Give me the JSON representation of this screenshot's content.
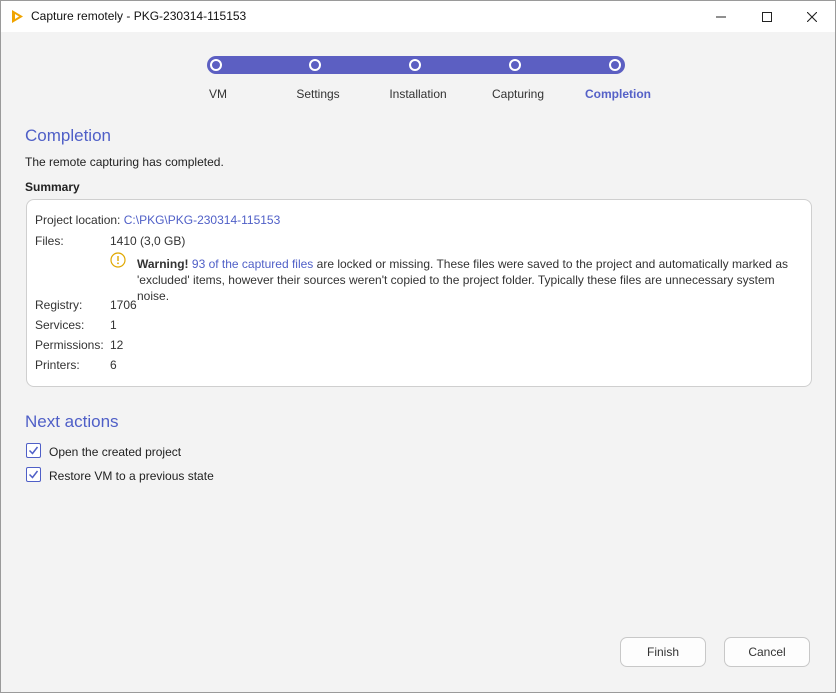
{
  "window": {
    "title": "Capture remotely - PKG-230314-115153",
    "brand_color": "#f0a400",
    "accent_color": "#5c5fc2"
  },
  "stepper": {
    "steps": [
      {
        "label": "VM"
      },
      {
        "label": "Settings"
      },
      {
        "label": "Installation"
      },
      {
        "label": "Capturing"
      },
      {
        "label": "Completion",
        "active": true
      }
    ]
  },
  "completion": {
    "heading": "Completion",
    "message": "The remote capturing has completed.",
    "summary_label": "Summary"
  },
  "summary": {
    "project_location_label": "Project location:",
    "project_location_value": "C:\\PKG\\PKG-230314-115153",
    "files_label": "Files:",
    "files_value": "1410 (3,0 GB)",
    "warning_title": "Warning!",
    "warning_link": "93 of the captured files",
    "warning_text": " are locked or missing. These files were saved to the project and automatically marked as 'excluded' items, however their sources weren't copied to the project folder. Typically these files are unnecessary system noise.",
    "registry_label": "Registry:",
    "registry_value": "1706",
    "services_label": "Services:",
    "services_value": "1",
    "permissions_label": "Permissions:",
    "permissions_value": "12",
    "printers_label": "Printers:",
    "printers_value": "6"
  },
  "next_actions": {
    "heading": "Next actions",
    "items": [
      {
        "label": "Open the created project",
        "checked": true
      },
      {
        "label": "Restore VM to a previous state",
        "checked": true
      }
    ]
  },
  "footer": {
    "finish_label": "Finish",
    "cancel_label": "Cancel"
  },
  "icons": {
    "app": "capture-app-icon",
    "minimize": "minimize-icon",
    "maximize": "maximize-icon",
    "close": "close-icon",
    "warning": "warning-icon",
    "check": "checkmark-icon"
  }
}
